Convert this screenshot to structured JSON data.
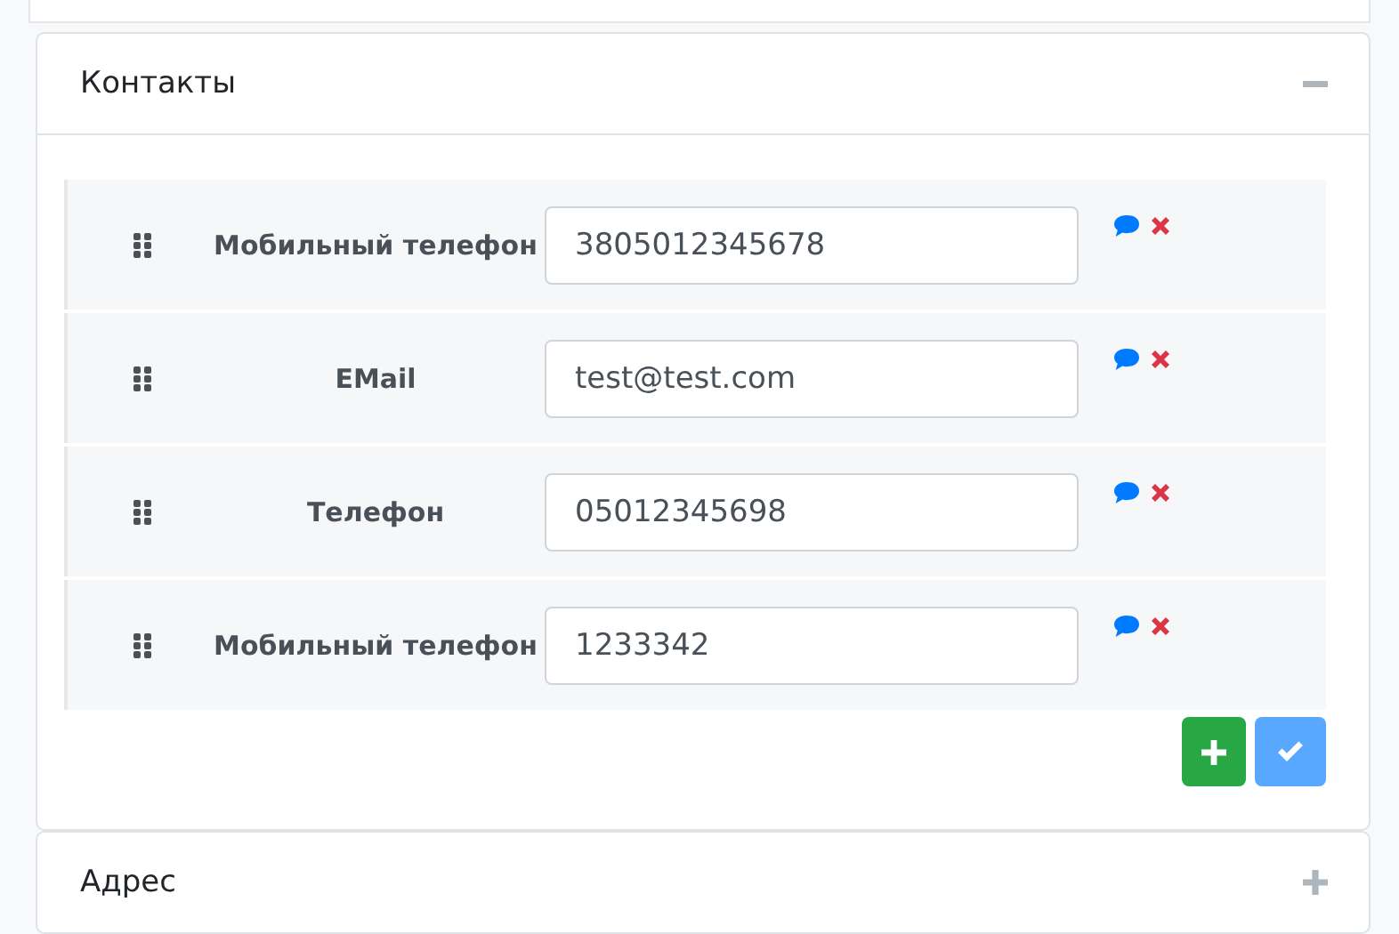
{
  "sections": [
    {
      "title": "Контакты",
      "expanded": true,
      "contacts": [
        {
          "label": "Мобильный телефон",
          "value": "3805012345678"
        },
        {
          "label": "EMail",
          "value": "test@test.com"
        },
        {
          "label": "Телефон",
          "value": "05012345698"
        },
        {
          "label": "Мобильный телефон",
          "value": "1233342"
        }
      ],
      "actions": [
        {
          "kind": "add",
          "disabled": false
        },
        {
          "kind": "confirm",
          "disabled": true
        }
      ]
    },
    {
      "title": "Адрес",
      "expanded": false
    }
  ]
}
